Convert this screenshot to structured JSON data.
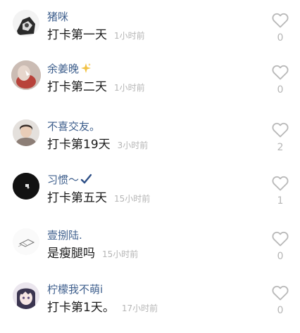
{
  "comments": [
    {
      "username": "猪咪",
      "content": "打卡第一天",
      "time": "1小时前",
      "likes": "0",
      "avatar_icon": "cartoon-avatar-icon"
    },
    {
      "username": "余姜晚",
      "badge": "sparkle-icon",
      "content": "打卡第二天",
      "time": "1小时前",
      "likes": "0",
      "avatar_icon": "red-portrait-avatar-icon"
    },
    {
      "username": "不喜交友。",
      "content": "打卡第19天",
      "time": "3小时前",
      "likes": "2",
      "avatar_icon": "person-photo-avatar-icon"
    },
    {
      "username": "习惯～",
      "badge": "checkmark-icon",
      "content": "打卡第五天",
      "time": "15小时前",
      "likes": "1",
      "avatar_icon": "dark-avatar-icon"
    },
    {
      "username": "壹捌陆.",
      "content": "是瘦腿吗",
      "time": "15小时前",
      "likes": "0",
      "avatar_icon": "sketch-avatar-icon"
    },
    {
      "username": "柠檬我不萌i",
      "content": "打卡第1天。",
      "time": "17小时前",
      "likes": "0",
      "avatar_icon": "anime-girl-avatar-icon"
    }
  ],
  "colors": {
    "username": "#3d5e8c",
    "content": "#1a1a1a",
    "meta": "#b5b5b5",
    "heart_outline": "#b8b8b8"
  }
}
